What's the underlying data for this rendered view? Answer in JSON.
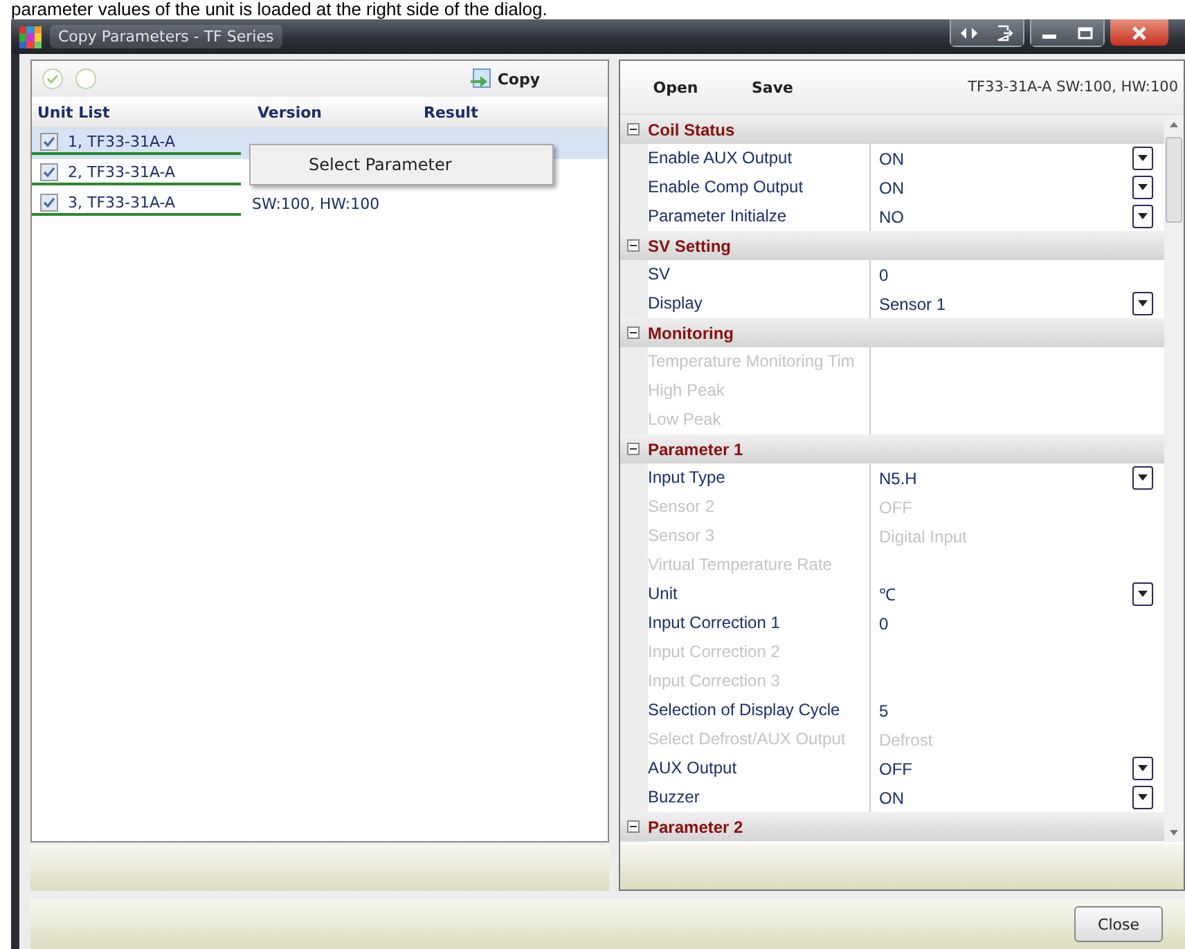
{
  "caption": "parameter values of the unit is loaded at the right side of the dialog.",
  "window": {
    "title": "Copy Parameters - TF Series"
  },
  "left_panel": {
    "copy_button": "Copy",
    "columns": [
      "Unit List",
      "Version",
      "Result"
    ],
    "rows": [
      {
        "name": "1, TF33-31A-A",
        "checked": true,
        "selected": true
      },
      {
        "name": "2, TF33-31A-A",
        "checked": true,
        "selected": false
      },
      {
        "name": "3, TF33-31A-A",
        "version": "SW:100, HW:100",
        "checked": true,
        "selected": false
      }
    ],
    "context_menu": {
      "items": [
        "Select Parameter"
      ]
    }
  },
  "right_panel": {
    "open_button": "Open",
    "save_button": "Save",
    "unit_info": "TF33-31A-A  SW:100, HW:100",
    "grid": [
      {
        "kind": "header",
        "label": "Coil Status",
        "expanded": true
      },
      {
        "kind": "property",
        "label": "Enable AUX Output",
        "value": "ON",
        "disabled": false,
        "dropdown": true
      },
      {
        "kind": "property",
        "label": "Enable Comp Output",
        "value": "ON",
        "disabled": false,
        "dropdown": true
      },
      {
        "kind": "property",
        "label": "Parameter Initialze",
        "value": "NO",
        "disabled": false,
        "dropdown": true
      },
      {
        "kind": "header",
        "label": "SV Setting",
        "expanded": true
      },
      {
        "kind": "property",
        "label": "SV",
        "value": "0",
        "disabled": false,
        "dropdown": false
      },
      {
        "kind": "property",
        "label": "Display",
        "value": "Sensor 1",
        "disabled": false,
        "dropdown": true
      },
      {
        "kind": "header",
        "label": "Monitoring",
        "expanded": true
      },
      {
        "kind": "property",
        "label": "Temperature Monitoring Tim",
        "disabled": true,
        "dropdown": false
      },
      {
        "kind": "property",
        "label": "High Peak",
        "disabled": true,
        "dropdown": false
      },
      {
        "kind": "property",
        "label": "Low Peak",
        "disabled": true,
        "dropdown": false
      },
      {
        "kind": "header",
        "label": "Parameter 1",
        "expanded": true
      },
      {
        "kind": "property",
        "label": "Input Type",
        "value": "N5.H",
        "disabled": false,
        "dropdown": true
      },
      {
        "kind": "property",
        "label": "Sensor 2",
        "value": "OFF",
        "disabled": true,
        "dropdown": false
      },
      {
        "kind": "property",
        "label": "Sensor 3",
        "value": "Digital Input",
        "disabled": true,
        "dropdown": false
      },
      {
        "kind": "property",
        "label": "Virtual Temperature Rate",
        "disabled": true,
        "dropdown": false
      },
      {
        "kind": "property",
        "label": "Unit",
        "value": "℃",
        "disabled": false,
        "dropdown": true
      },
      {
        "kind": "property",
        "label": "Input Correction 1",
        "value": "0",
        "disabled": false,
        "dropdown": false
      },
      {
        "kind": "property",
        "label": "Input Correction 2",
        "disabled": true,
        "dropdown": false
      },
      {
        "kind": "property",
        "label": "Input Correction 3",
        "disabled": true,
        "dropdown": false
      },
      {
        "kind": "property",
        "label": "Selection of Display Cycle",
        "value": "5",
        "disabled": false,
        "dropdown": false
      },
      {
        "kind": "property",
        "label": "Select Defrost/AUX Output",
        "value": "Defrost",
        "disabled": true,
        "dropdown": false
      },
      {
        "kind": "property",
        "label": "AUX Output",
        "value": "OFF",
        "disabled": false,
        "dropdown": true
      },
      {
        "kind": "property",
        "label": "Buzzer",
        "value": "ON",
        "disabled": false,
        "dropdown": true
      },
      {
        "kind": "header",
        "label": "Parameter 2",
        "expanded": true
      }
    ]
  },
  "close_button": "Close"
}
